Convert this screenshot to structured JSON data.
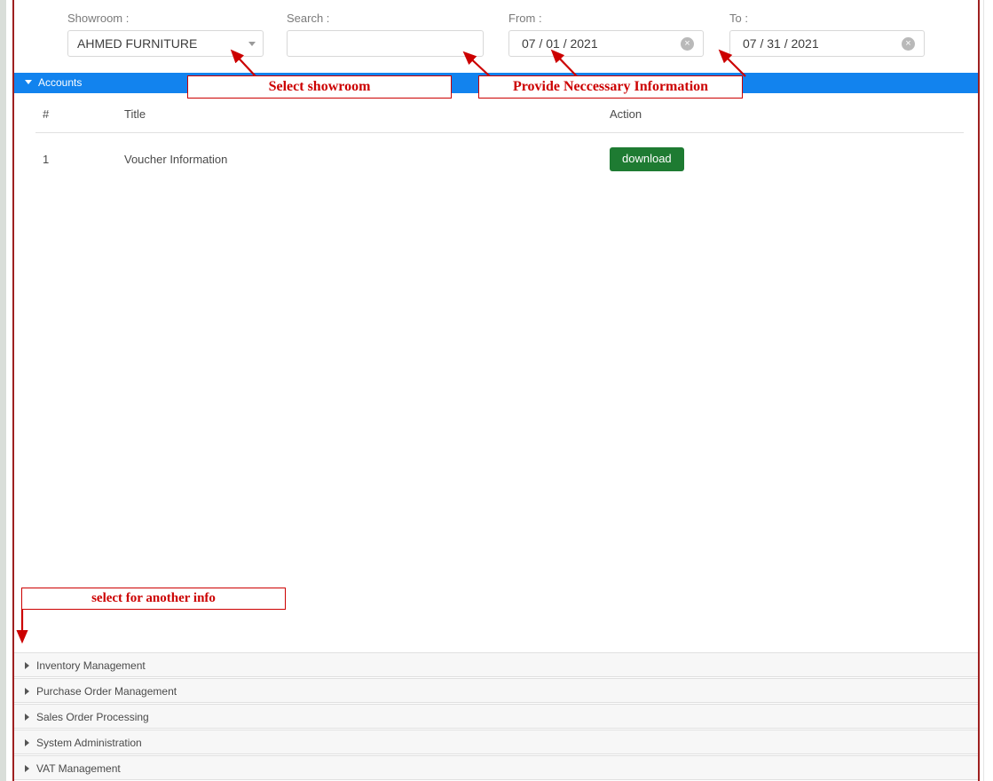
{
  "filters": {
    "showroom": {
      "label": "Showroom :",
      "value": "AHMED FURNITURE",
      "caret_icon": "chevron-down-icon"
    },
    "search": {
      "label": "Search :",
      "value": "",
      "placeholder": ""
    },
    "from": {
      "label": "From :",
      "value": "07 / 01 / 2021",
      "clear_icon": "circle-x-icon",
      "clear_glyph": "×"
    },
    "to": {
      "label": "To :",
      "value": "07 / 31 / 2021",
      "clear_icon": "circle-x-icon",
      "clear_glyph": "×"
    }
  },
  "accordion": {
    "open_panel": {
      "label": "Accounts",
      "expanded": true,
      "header_color": "#1283ee",
      "caret_icon": "caret-down-icon"
    },
    "collapsed_panels": [
      {
        "label": "Inventory Management",
        "caret_icon": "caret-right-icon"
      },
      {
        "label": "Purchase Order Management",
        "caret_icon": "caret-right-icon"
      },
      {
        "label": "Sales Order Processing",
        "caret_icon": "caret-right-icon"
      },
      {
        "label": "System Administration",
        "caret_icon": "caret-right-icon"
      },
      {
        "label": "VAT Management",
        "caret_icon": "caret-right-icon"
      }
    ]
  },
  "table": {
    "columns": [
      "#",
      "Title",
      "Action"
    ],
    "rows": [
      {
        "num": "1",
        "title": "Voucher Information",
        "action_label": "download",
        "action_color": "#1e7b32"
      }
    ]
  },
  "annotations": [
    {
      "id": "select-showroom",
      "text": "Select showroom"
    },
    {
      "id": "provide-info",
      "text": "Provide Neccessary Information"
    },
    {
      "id": "select-another",
      "text": "select for another info"
    }
  ],
  "colors": {
    "accent_blue": "#1283ee",
    "annotation_red": "#cc0000",
    "frame_red": "#9e2020",
    "download_green": "#1e7b32"
  }
}
